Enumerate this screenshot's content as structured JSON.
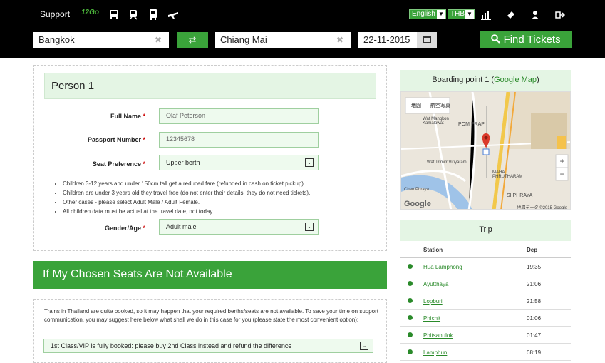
{
  "nav": {
    "support": "Support",
    "logo": "12Go",
    "icons": [
      "bus-icon",
      "train-icon",
      "metro-icon",
      "flight-icon"
    ],
    "language": "English",
    "currency": "THB",
    "right_icons": [
      "chart-icon",
      "ticket-icon",
      "user-icon",
      "logout-icon"
    ]
  },
  "search": {
    "from": "Bangkok",
    "to": "Chiang Mai",
    "date": "22-11-2015",
    "find_label": "Find Tickets",
    "swap_icon": "⇄"
  },
  "person": {
    "title": "Person 1",
    "full_name_label": "Full Name",
    "full_name_value": "Olaf Peterson",
    "passport_label": "Passport Number",
    "passport_value": "12345678",
    "seat_label": "Seat Preference",
    "seat_value": "Upper berth",
    "gender_label": "Gender/Age",
    "gender_value": "Adult male",
    "req": "*",
    "notes": [
      "Children 3-12 years and under 150cm tall get a reduced fare (refunded in cash on ticket pickup).",
      "Children are under 3 years old they travel free (do not enter their details, they do not need tickets).",
      "Other cases - please select Adult Male / Adult Female.",
      "All children data must be actual at the travel date, not today."
    ]
  },
  "availability": {
    "title": "If My Chosen Seats Are Not Available",
    "text": "Trains in Thailand are quite booked, so it may happen that your required berths/seats are not available. To save your time on support communication, you may suggest here below what shall we do in this case for you (please state the most convenient option):",
    "option": "1st Class/VIP is fully booked: please buy 2nd Class instead and refund the difference"
  },
  "boarding": {
    "title": "Boarding point 1 (",
    "link": "Google Map",
    "close": ")",
    "map_tabs": [
      "地図",
      "航空写真"
    ],
    "map_labels": [
      "Wat Mangkon Kamalawat",
      "POM PRAP",
      "Wat Trimitr Viriyaram",
      "MAHA PHRUTHARAM",
      "SI PHRAYA",
      "Chao Phraya"
    ],
    "map_footer": "地図データ ©2015 Google",
    "google": "Google"
  },
  "trip": {
    "title": "Trip",
    "col_station": "Station",
    "col_dep": "Dep",
    "rows": [
      {
        "station": "Hua Lamphong",
        "dep": "19:35"
      },
      {
        "station": "Ayutthaya",
        "dep": "21:06"
      },
      {
        "station": "Lopburi",
        "dep": "21:58"
      },
      {
        "station": "Phichit",
        "dep": "01:06"
      },
      {
        "station": "Phitsanulok",
        "dep": "01:47"
      },
      {
        "station": "Lamphun",
        "dep": "08:19"
      }
    ]
  }
}
